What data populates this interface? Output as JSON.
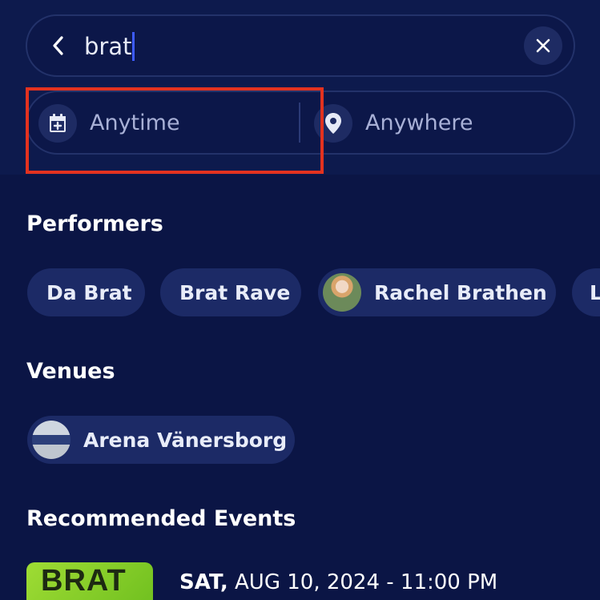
{
  "search": {
    "query": "brat",
    "anytime_label": "Anytime",
    "anywhere_label": "Anywhere"
  },
  "sections": {
    "performers_title": "Performers",
    "venues_title": "Venues",
    "recommended_title": "Recommended Events"
  },
  "performers": [
    {
      "label": "Da Brat"
    },
    {
      "label": "Brat Rave"
    },
    {
      "label": "Rachel Brathen"
    },
    {
      "label": "L"
    }
  ],
  "venues": [
    {
      "label": "Arena Vänersborg"
    }
  ],
  "events": [
    {
      "thumb_text": "BRAT",
      "day": "SAT,",
      "date": "AUG 10, 2024 - 11:00 PM"
    }
  ],
  "icons": {
    "back": "chevron-left-icon",
    "clear": "close-icon",
    "anytime": "calendar-add-icon",
    "anywhere": "map-pin-icon"
  },
  "colors": {
    "background": "#0b1545",
    "pill": "#1c2a66",
    "highlight": "#e3321f",
    "caret": "#3d5bff"
  }
}
